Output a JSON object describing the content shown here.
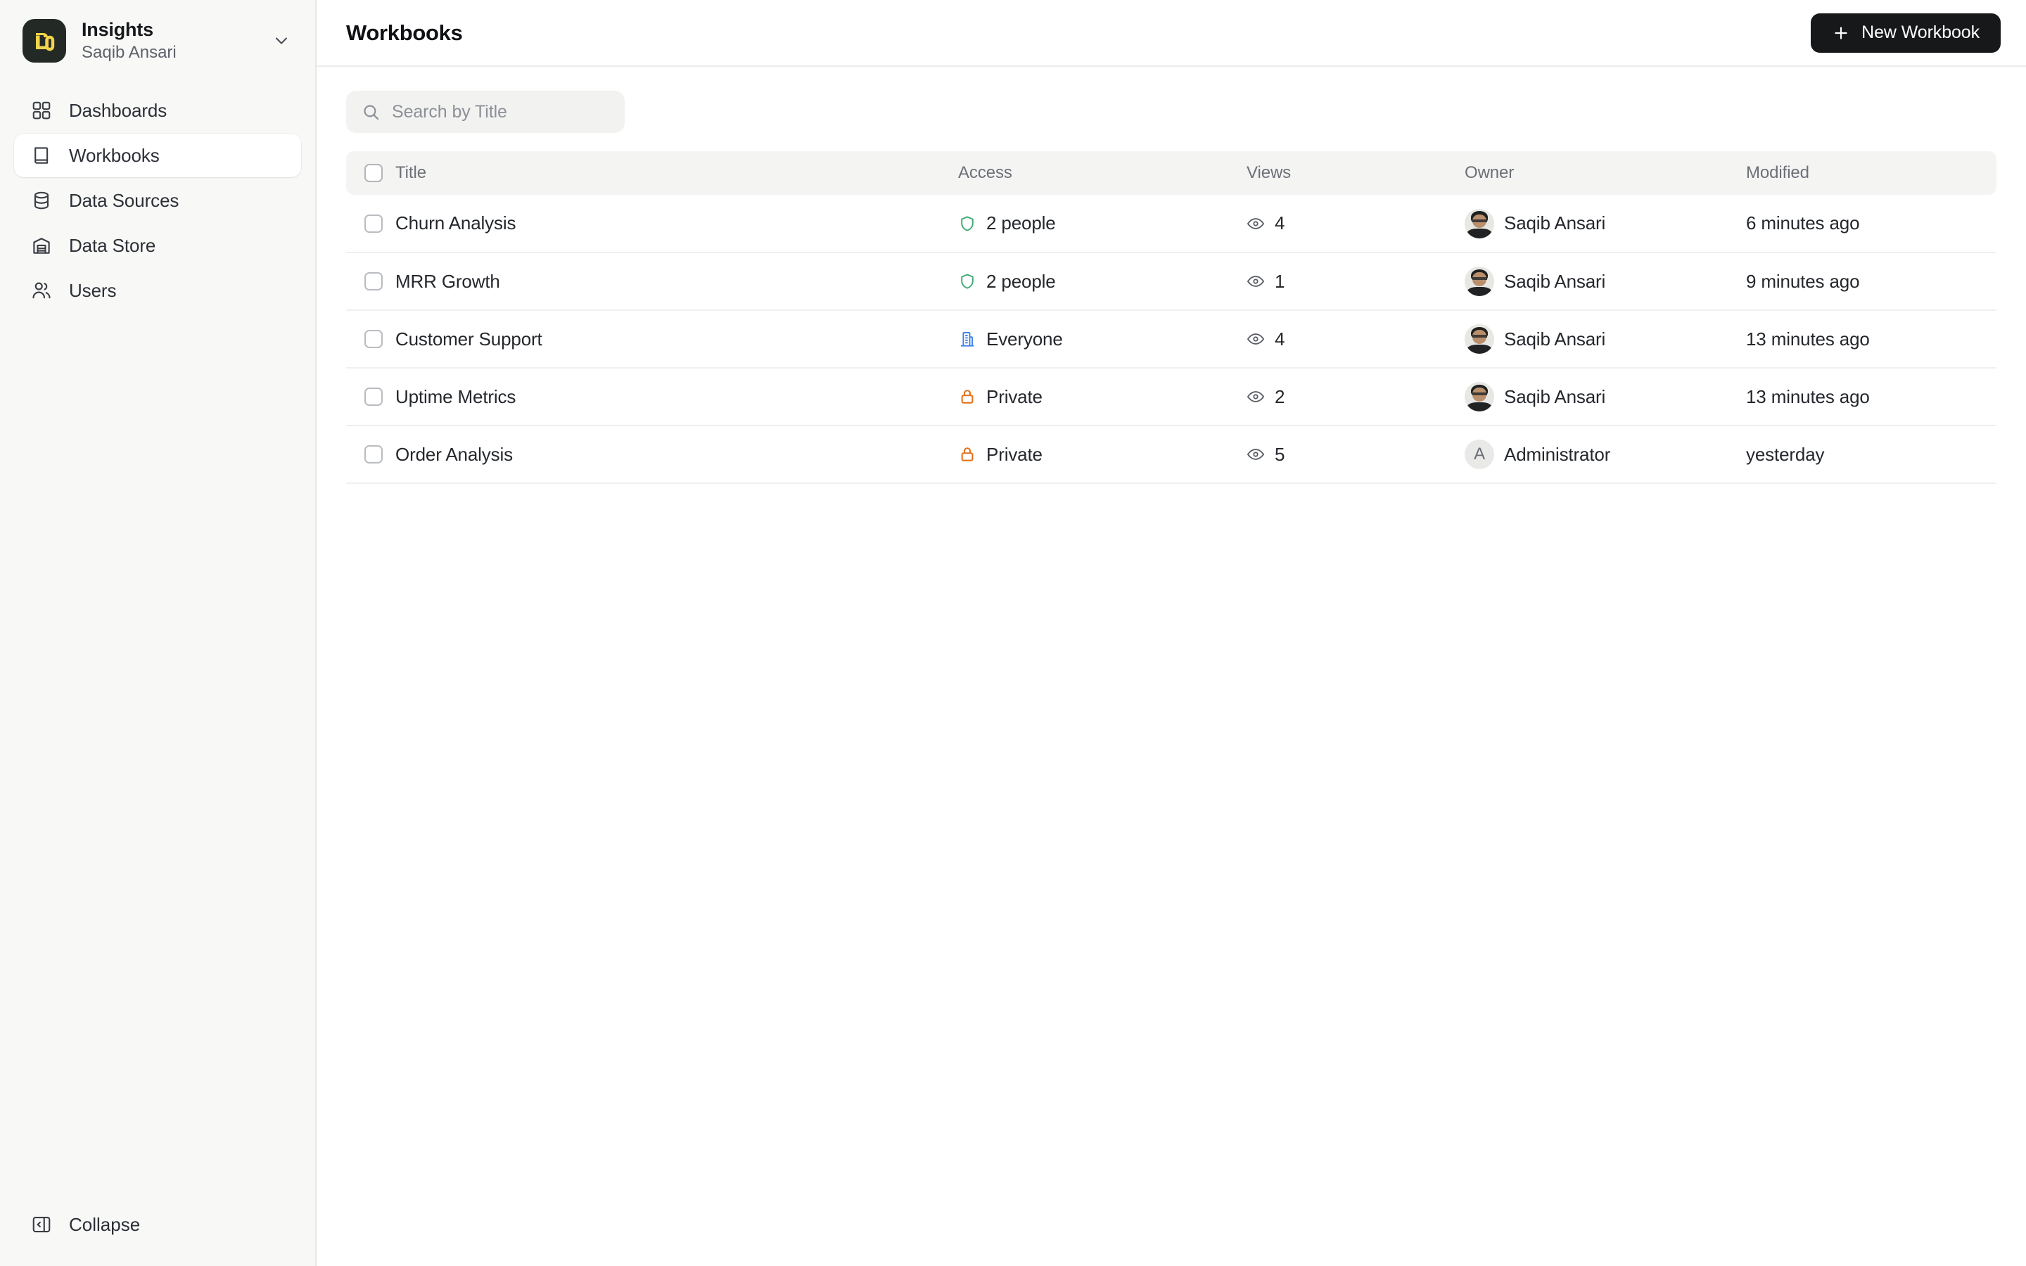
{
  "workspace": {
    "name": "Insights",
    "user": "Saqib Ansari",
    "logo_icon": "db-logo-icon",
    "chevron_icon": "chevron-down-icon"
  },
  "sidebar": {
    "items": [
      {
        "label": "Dashboards",
        "icon": "grid-icon",
        "active": false
      },
      {
        "label": "Workbooks",
        "icon": "book-icon",
        "active": true
      },
      {
        "label": "Data Sources",
        "icon": "database-icon",
        "active": false
      },
      {
        "label": "Data Store",
        "icon": "warehouse-icon",
        "active": false
      },
      {
        "label": "Users",
        "icon": "users-icon",
        "active": false
      }
    ],
    "collapse": {
      "label": "Collapse",
      "icon": "collapse-panel-icon"
    }
  },
  "header": {
    "title": "Workbooks",
    "new_workbook_label": "New Workbook",
    "plus_icon": "plus-icon"
  },
  "search": {
    "placeholder": "Search by Title",
    "value": "",
    "icon": "search-icon"
  },
  "table": {
    "columns": [
      "Title",
      "Access",
      "Views",
      "Owner",
      "Modified"
    ],
    "rows": [
      {
        "title": "Churn Analysis",
        "access": "2 people",
        "access_icon": "shield-icon",
        "access_color": "#3fab74",
        "views": "4",
        "views_icon": "eye-icon",
        "owner": "Saqib Ansari",
        "owner_avatar": "photo",
        "modified": "6 minutes ago",
        "selected": false
      },
      {
        "title": "MRR Growth",
        "access": "2 people",
        "access_icon": "shield-icon",
        "access_color": "#3fab74",
        "views": "1",
        "views_icon": "eye-icon",
        "owner": "Saqib Ansari",
        "owner_avatar": "photo",
        "modified": "9 minutes ago",
        "selected": false
      },
      {
        "title": "Customer Support",
        "access": "Everyone",
        "access_icon": "building-icon",
        "access_color": "#3b7fe8",
        "views": "4",
        "views_icon": "eye-icon",
        "owner": "Saqib Ansari",
        "owner_avatar": "photo",
        "modified": "13 minutes ago",
        "selected": false
      },
      {
        "title": "Uptime Metrics",
        "access": "Private",
        "access_icon": "lock-icon",
        "access_color": "#e2711d",
        "views": "2",
        "views_icon": "eye-icon",
        "owner": "Saqib Ansari",
        "owner_avatar": "photo",
        "modified": "13 minutes ago",
        "selected": false
      },
      {
        "title": "Order Analysis",
        "access": "Private",
        "access_icon": "lock-icon",
        "access_color": "#e2711d",
        "views": "5",
        "views_icon": "eye-icon",
        "owner": "Administrator",
        "owner_avatar": "letter",
        "owner_initial": "A",
        "modified": "yesterday",
        "selected": false
      }
    ],
    "select_all": false
  },
  "colors": {
    "brand_dark": "#232a26",
    "brand_yellow": "#f3d44b",
    "sidebar_bg": "#f8f8f7",
    "button_dark": "#17181a",
    "access_green": "#3fab74",
    "access_blue": "#3b7fe8",
    "access_orange": "#e2711d"
  }
}
